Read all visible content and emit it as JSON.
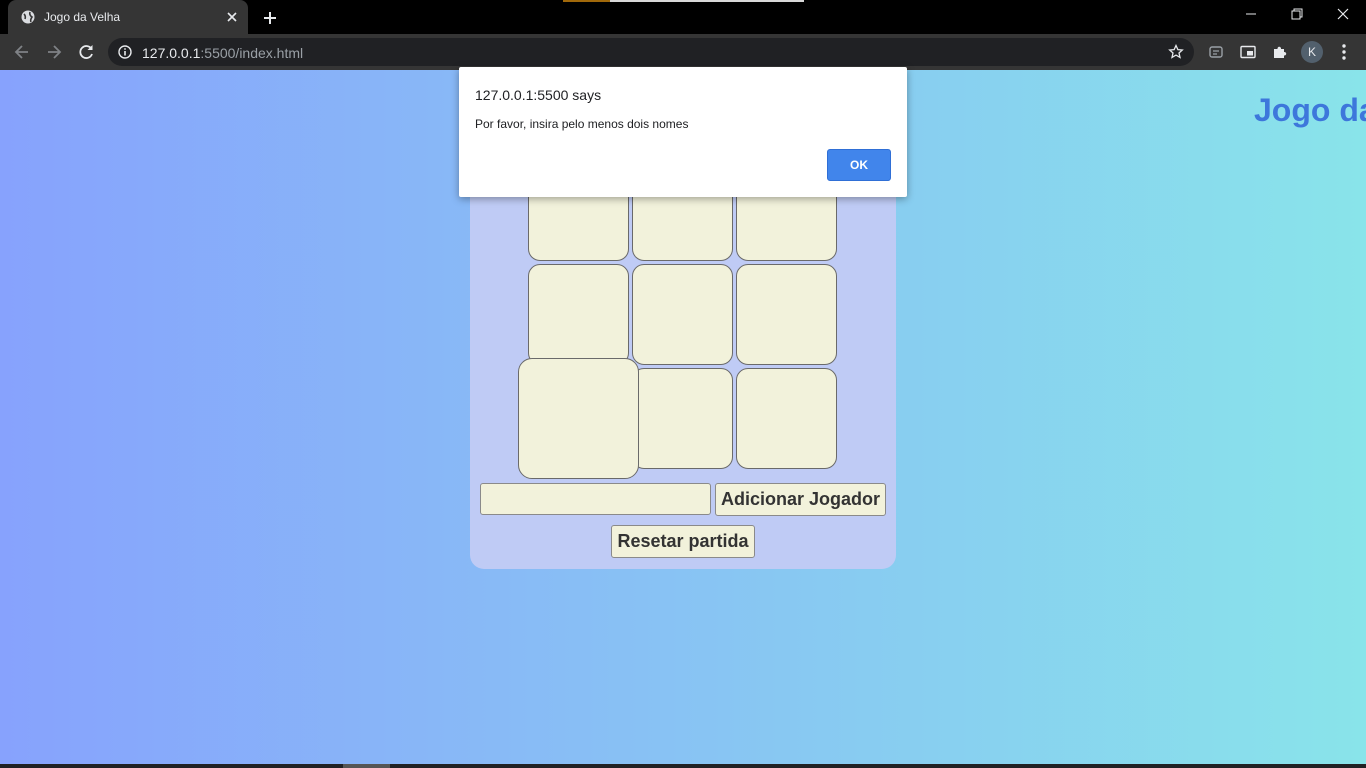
{
  "browser": {
    "tab": {
      "title": "Jogo da Velha",
      "favicon": "globe-icon"
    },
    "address": {
      "host": "127.0.0.1",
      "rest": ":5500/index.html"
    },
    "avatar_initial": "K"
  },
  "page": {
    "title": "Jogo da Velha",
    "board": {
      "rows": 3,
      "cols": 3
    },
    "name_input": {
      "value": "",
      "placeholder": ""
    },
    "add_button": "Adicionar Jogador",
    "reset_button": "Resetar partida"
  },
  "dialog": {
    "origin": "127.0.0.1:5500 says",
    "message": "Por favor, insira pelo menos dois nomes",
    "ok": "OK"
  },
  "colors": {
    "gradient_left": "#87a2fd",
    "gradient_right": "#89e4ea",
    "title_blue": "#3d77db",
    "cell_fill": "#f2f2db",
    "card_fill": "#bfcbf5",
    "ok_button": "#4185eb"
  }
}
